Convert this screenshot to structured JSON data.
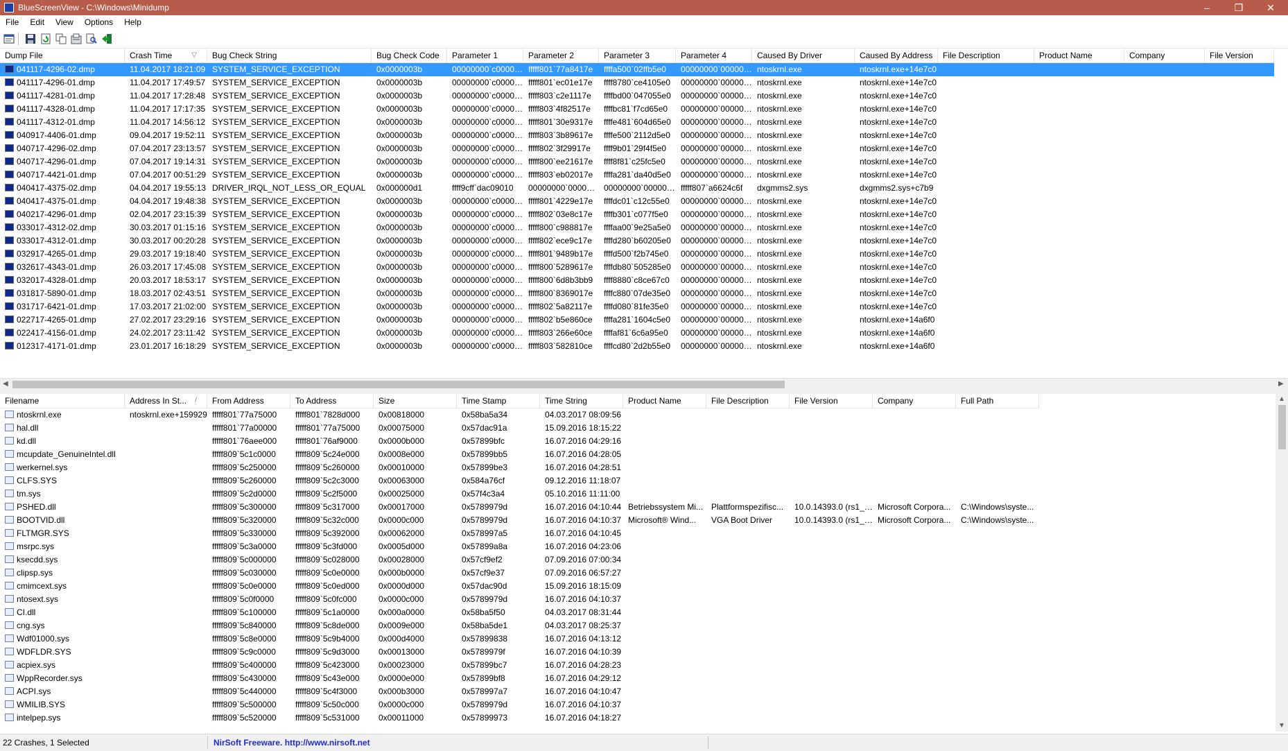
{
  "window": {
    "title": "BlueScreenView  -  C:\\Windows\\Minidump",
    "minimize": "–",
    "maximize": "❐",
    "close": "✕"
  },
  "menu": [
    "File",
    "Edit",
    "View",
    "Options",
    "Help"
  ],
  "toolbar": [
    "properties-icon",
    "save-icon",
    "refresh-icon",
    "copy-icon",
    "options-icon",
    "find-icon",
    "exit-icon"
  ],
  "crashes": {
    "columns": [
      "Dump File",
      "Crash Time",
      "Bug Check String",
      "Bug Check Code",
      "Parameter 1",
      "Parameter 2",
      "Parameter 3",
      "Parameter 4",
      "Caused By Driver",
      "Caused By Address",
      "File Description",
      "Product Name",
      "Company",
      "File Version"
    ],
    "sort_indicator": "▽",
    "rows": [
      [
        "041117-4296-02.dmp",
        "11.04.2017 18:21:09",
        "SYSTEM_SERVICE_EXCEPTION",
        "0x0000003b",
        "00000000`c00000...",
        "fffff801`77a8417e",
        "ffffa500`02ffb5e0",
        "00000000`000000...",
        "ntoskrnl.exe",
        "ntoskrnl.exe+14e7c0",
        "",
        "",
        "",
        ""
      ],
      [
        "041117-4296-01.dmp",
        "11.04.2017 17:49:57",
        "SYSTEM_SERVICE_EXCEPTION",
        "0x0000003b",
        "00000000`c00000...",
        "fffff801`ec01e17e",
        "ffff8780`ce4105e0",
        "00000000`000000...",
        "ntoskrnl.exe",
        "ntoskrnl.exe+14e7c0",
        "",
        "",
        "",
        ""
      ],
      [
        "041117-4281-01.dmp",
        "11.04.2017 17:28:48",
        "SYSTEM_SERVICE_EXCEPTION",
        "0x0000003b",
        "00000000`c00000...",
        "fffff803`c2e1117e",
        "ffffbd00`047055e0",
        "00000000`000000...",
        "ntoskrnl.exe",
        "ntoskrnl.exe+14e7c0",
        "",
        "",
        "",
        ""
      ],
      [
        "041117-4328-01.dmp",
        "11.04.2017 17:17:35",
        "SYSTEM_SERVICE_EXCEPTION",
        "0x0000003b",
        "00000000`c00000...",
        "fffff803`4f82517e",
        "ffffbc81`f7cd65e0",
        "00000000`000000...",
        "ntoskrnl.exe",
        "ntoskrnl.exe+14e7c0",
        "",
        "",
        "",
        ""
      ],
      [
        "041117-4312-01.dmp",
        "11.04.2017 14:56:12",
        "SYSTEM_SERVICE_EXCEPTION",
        "0x0000003b",
        "00000000`c00000...",
        "fffff801`30e9317e",
        "ffffe481`604d65e0",
        "00000000`000000...",
        "ntoskrnl.exe",
        "ntoskrnl.exe+14e7c0",
        "",
        "",
        "",
        ""
      ],
      [
        "040917-4406-01.dmp",
        "09.04.2017 19:52:11",
        "SYSTEM_SERVICE_EXCEPTION",
        "0x0000003b",
        "00000000`c00000...",
        "fffff803`3b89617e",
        "ffffe500`2112d5e0",
        "00000000`000000...",
        "ntoskrnl.exe",
        "ntoskrnl.exe+14e7c0",
        "",
        "",
        "",
        ""
      ],
      [
        "040717-4296-02.dmp",
        "07.04.2017 23:13:57",
        "SYSTEM_SERVICE_EXCEPTION",
        "0x0000003b",
        "00000000`c00000...",
        "fffff802`3f29917e",
        "ffff9b01`29f4f5e0",
        "00000000`000000...",
        "ntoskrnl.exe",
        "ntoskrnl.exe+14e7c0",
        "",
        "",
        "",
        ""
      ],
      [
        "040717-4296-01.dmp",
        "07.04.2017 19:14:31",
        "SYSTEM_SERVICE_EXCEPTION",
        "0x0000003b",
        "00000000`c00000...",
        "fffff800`ee21617e",
        "ffff8f81`c25fc5e0",
        "00000000`000000...",
        "ntoskrnl.exe",
        "ntoskrnl.exe+14e7c0",
        "",
        "",
        "",
        ""
      ],
      [
        "040717-4421-01.dmp",
        "07.04.2017 00:51:29",
        "SYSTEM_SERVICE_EXCEPTION",
        "0x0000003b",
        "00000000`c00000...",
        "fffff803`eb02017e",
        "ffffa281`da40d5e0",
        "00000000`000000...",
        "ntoskrnl.exe",
        "ntoskrnl.exe+14e7c0",
        "",
        "",
        "",
        ""
      ],
      [
        "040417-4375-02.dmp",
        "04.04.2017 19:55:13",
        "DRIVER_IRQL_NOT_LESS_OR_EQUAL",
        "0x000000d1",
        "ffff9cff`dac09010",
        "00000000`000000...",
        "00000000`000000...",
        "fffff807`a6624c6f",
        "dxgmms2.sys",
        "dxgmms2.sys+c7b9",
        "",
        "",
        "",
        ""
      ],
      [
        "040417-4375-01.dmp",
        "04.04.2017 19:48:38",
        "SYSTEM_SERVICE_EXCEPTION",
        "0x0000003b",
        "00000000`c00000...",
        "fffff801`4229e17e",
        "ffffdc01`c12c55e0",
        "00000000`000000...",
        "ntoskrnl.exe",
        "ntoskrnl.exe+14e7c0",
        "",
        "",
        "",
        ""
      ],
      [
        "040217-4296-01.dmp",
        "02.04.2017 23:15:39",
        "SYSTEM_SERVICE_EXCEPTION",
        "0x0000003b",
        "00000000`c00000...",
        "fffff802`03e8c17e",
        "ffffb301`c077f5e0",
        "00000000`000000...",
        "ntoskrnl.exe",
        "ntoskrnl.exe+14e7c0",
        "",
        "",
        "",
        ""
      ],
      [
        "033017-4312-02.dmp",
        "30.03.2017 01:15:16",
        "SYSTEM_SERVICE_EXCEPTION",
        "0x0000003b",
        "00000000`c00000...",
        "fffff800`c988817e",
        "ffffaa00`9e25a5e0",
        "00000000`000000...",
        "ntoskrnl.exe",
        "ntoskrnl.exe+14e7c0",
        "",
        "",
        "",
        ""
      ],
      [
        "033017-4312-01.dmp",
        "30.03.2017 00:20:28",
        "SYSTEM_SERVICE_EXCEPTION",
        "0x0000003b",
        "00000000`c00000...",
        "fffff802`ece9c17e",
        "ffffd280`b60205e0",
        "00000000`000000...",
        "ntoskrnl.exe",
        "ntoskrnl.exe+14e7c0",
        "",
        "",
        "",
        ""
      ],
      [
        "032917-4265-01.dmp",
        "29.03.2017 19:18:40",
        "SYSTEM_SERVICE_EXCEPTION",
        "0x0000003b",
        "00000000`c00000...",
        "fffff801`9489b17e",
        "ffffd500`f2b745e0",
        "00000000`000000...",
        "ntoskrnl.exe",
        "ntoskrnl.exe+14e7c0",
        "",
        "",
        "",
        ""
      ],
      [
        "032617-4343-01.dmp",
        "26.03.2017 17:45:08",
        "SYSTEM_SERVICE_EXCEPTION",
        "0x0000003b",
        "00000000`c00000...",
        "fffff800`5289617e",
        "ffffdb80`505285e0",
        "00000000`000000...",
        "ntoskrnl.exe",
        "ntoskrnl.exe+14e7c0",
        "",
        "",
        "",
        ""
      ],
      [
        "032017-4328-01.dmp",
        "20.03.2017 18:53:17",
        "SYSTEM_SERVICE_EXCEPTION",
        "0x0000003b",
        "00000000`c00000...",
        "fffff800`6d8b3bb9",
        "ffff8880`c8ce67c0",
        "00000000`000000...",
        "ntoskrnl.exe",
        "ntoskrnl.exe+14e7c0",
        "",
        "",
        "",
        ""
      ],
      [
        "031817-5890-01.dmp",
        "18.03.2017 02:43:51",
        "SYSTEM_SERVICE_EXCEPTION",
        "0x0000003b",
        "00000000`c00000...",
        "fffff800`8369017e",
        "ffffc880`07de35e0",
        "00000000`000000...",
        "ntoskrnl.exe",
        "ntoskrnl.exe+14e7c0",
        "",
        "",
        "",
        ""
      ],
      [
        "031717-6421-01.dmp",
        "17.03.2017 21:02:00",
        "SYSTEM_SERVICE_EXCEPTION",
        "0x0000003b",
        "00000000`c00000...",
        "fffff802`5a82117e",
        "ffffd080`81fe35e0",
        "00000000`000000...",
        "ntoskrnl.exe",
        "ntoskrnl.exe+14e7c0",
        "",
        "",
        "",
        ""
      ],
      [
        "022717-4265-01.dmp",
        "27.02.2017 23:29:16",
        "SYSTEM_SERVICE_EXCEPTION",
        "0x0000003b",
        "00000000`c00000...",
        "fffff802`b5e860ce",
        "ffffa281`1604c5e0",
        "00000000`000000...",
        "ntoskrnl.exe",
        "ntoskrnl.exe+14a6f0",
        "",
        "",
        "",
        ""
      ],
      [
        "022417-4156-01.dmp",
        "24.02.2017 23:11:42",
        "SYSTEM_SERVICE_EXCEPTION",
        "0x0000003b",
        "00000000`c00000...",
        "fffff803`266e60ce",
        "ffffaf81`6c6a95e0",
        "00000000`000000...",
        "ntoskrnl.exe",
        "ntoskrnl.exe+14a6f0",
        "",
        "",
        "",
        ""
      ],
      [
        "012317-4171-01.dmp",
        "23.01.2017 16:18:29",
        "SYSTEM_SERVICE_EXCEPTION",
        "0x0000003b",
        "00000000`c00000...",
        "fffff803`582810ce",
        "ffffcd80`2d2b55e0",
        "00000000`000000...",
        "ntoskrnl.exe",
        "ntoskrnl.exe+14a6f0",
        "",
        "",
        "",
        ""
      ]
    ]
  },
  "modules": {
    "columns": [
      "Filename",
      "Address In St...",
      "From Address",
      "To Address",
      "Size",
      "Time Stamp",
      "Time String",
      "Product Name",
      "File Description",
      "File Version",
      "Company",
      "Full Path"
    ],
    "sort_indicator": "/",
    "rows": [
      [
        "ntoskrnl.exe",
        "ntoskrnl.exe+159929",
        "fffff801`77a75000",
        "fffff801`7828d000",
        "0x00818000",
        "0x58ba5a34",
        "04.03.2017 08:09:56",
        "",
        "",
        "",
        "",
        ""
      ],
      [
        "hal.dll",
        "",
        "fffff801`77a00000",
        "fffff801`77a75000",
        "0x00075000",
        "0x57dac91a",
        "15.09.2016 18:15:22",
        "",
        "",
        "",
        "",
        ""
      ],
      [
        "kd.dll",
        "",
        "fffff801`76aee000",
        "fffff801`76af9000",
        "0x0000b000",
        "0x57899bfc",
        "16.07.2016 04:29:16",
        "",
        "",
        "",
        "",
        ""
      ],
      [
        "mcupdate_GenuineIntel.dll",
        "",
        "fffff809`5c1c0000",
        "fffff809`5c24e000",
        "0x0008e000",
        "0x57899bb5",
        "16.07.2016 04:28:05",
        "",
        "",
        "",
        "",
        ""
      ],
      [
        "werkernel.sys",
        "",
        "fffff809`5c250000",
        "fffff809`5c260000",
        "0x00010000",
        "0x57899be3",
        "16.07.2016 04:28:51",
        "",
        "",
        "",
        "",
        ""
      ],
      [
        "CLFS.SYS",
        "",
        "fffff809`5c260000",
        "fffff809`5c2c3000",
        "0x00063000",
        "0x584a76cf",
        "09.12.2016 11:18:07",
        "",
        "",
        "",
        "",
        ""
      ],
      [
        "tm.sys",
        "",
        "fffff809`5c2d0000",
        "fffff809`5c2f5000",
        "0x00025000",
        "0x57f4c3a4",
        "05.10.2016 11:11:00",
        "",
        "",
        "",
        "",
        ""
      ],
      [
        "PSHED.dll",
        "",
        "fffff809`5c300000",
        "fffff809`5c317000",
        "0x00017000",
        "0x5789979d",
        "16.07.2016 04:10:44",
        "Betriebssystem Mi...",
        "Plattformspezifisc...",
        "10.0.14393.0 (rs1_r...",
        "Microsoft Corpora...",
        "C:\\Windows\\syste..."
      ],
      [
        "BOOTVID.dll",
        "",
        "fffff809`5c320000",
        "fffff809`5c32c000",
        "0x0000c000",
        "0x5789979d",
        "16.07.2016 04:10:37",
        "Microsoft® Wind...",
        "VGA Boot Driver",
        "10.0.14393.0 (rs1_r...",
        "Microsoft Corpora...",
        "C:\\Windows\\syste..."
      ],
      [
        "FLTMGR.SYS",
        "",
        "fffff809`5c330000",
        "fffff809`5c392000",
        "0x00062000",
        "0x578997a5",
        "16.07.2016 04:10:45",
        "",
        "",
        "",
        "",
        ""
      ],
      [
        "msrpc.sys",
        "",
        "fffff809`5c3a0000",
        "fffff809`5c3fd000",
        "0x0005d000",
        "0x57899a8a",
        "16.07.2016 04:23:06",
        "",
        "",
        "",
        "",
        ""
      ],
      [
        "ksecdd.sys",
        "",
        "fffff809`5c000000",
        "fffff809`5c028000",
        "0x00028000",
        "0x57cf9ef2",
        "07.09.2016 07:00:34",
        "",
        "",
        "",
        "",
        ""
      ],
      [
        "clipsp.sys",
        "",
        "fffff809`5c030000",
        "fffff809`5c0e0000",
        "0x000b0000",
        "0x57cf9e37",
        "07.09.2016 06:57:27",
        "",
        "",
        "",
        "",
        ""
      ],
      [
        "cmimcext.sys",
        "",
        "fffff809`5c0e0000",
        "fffff809`5c0ed000",
        "0x0000d000",
        "0x57dac90d",
        "15.09.2016 18:15:09",
        "",
        "",
        "",
        "",
        ""
      ],
      [
        "ntosext.sys",
        "",
        "fffff809`5c0f0000",
        "fffff809`5c0fc000",
        "0x0000c000",
        "0x5789979d",
        "16.07.2016 04:10:37",
        "",
        "",
        "",
        "",
        ""
      ],
      [
        "CI.dll",
        "",
        "fffff809`5c100000",
        "fffff809`5c1a0000",
        "0x000a0000",
        "0x58ba5f50",
        "04.03.2017 08:31:44",
        "",
        "",
        "",
        "",
        ""
      ],
      [
        "cng.sys",
        "",
        "fffff809`5c840000",
        "fffff809`5c8de000",
        "0x0009e000",
        "0x58ba5de1",
        "04.03.2017 08:25:37",
        "",
        "",
        "",
        "",
        ""
      ],
      [
        "Wdf01000.sys",
        "",
        "fffff809`5c8e0000",
        "fffff809`5c9b4000",
        "0x000d4000",
        "0x57899838",
        "16.07.2016 04:13:12",
        "",
        "",
        "",
        "",
        ""
      ],
      [
        "WDFLDR.SYS",
        "",
        "fffff809`5c9c0000",
        "fffff809`5c9d3000",
        "0x00013000",
        "0x5789979f",
        "16.07.2016 04:10:39",
        "",
        "",
        "",
        "",
        ""
      ],
      [
        "acpiex.sys",
        "",
        "fffff809`5c400000",
        "fffff809`5c423000",
        "0x00023000",
        "0x57899bc7",
        "16.07.2016 04:28:23",
        "",
        "",
        "",
        "",
        ""
      ],
      [
        "WppRecorder.sys",
        "",
        "fffff809`5c430000",
        "fffff809`5c43e000",
        "0x0000e000",
        "0x57899bf8",
        "16.07.2016 04:29:12",
        "",
        "",
        "",
        "",
        ""
      ],
      [
        "ACPI.sys",
        "",
        "fffff809`5c440000",
        "fffff809`5c4f3000",
        "0x000b3000",
        "0x578997a7",
        "16.07.2016 04:10:47",
        "",
        "",
        "",
        "",
        ""
      ],
      [
        "WMILIB.SYS",
        "",
        "fffff809`5c500000",
        "fffff809`5c50c000",
        "0x0000c000",
        "0x5789979d",
        "16.07.2016 04:10:37",
        "",
        "",
        "",
        "",
        ""
      ],
      [
        "intelpep.sys",
        "",
        "fffff809`5c520000",
        "fffff809`5c531000",
        "0x00011000",
        "0x57899973",
        "16.07.2016 04:18:27",
        "",
        "",
        "",
        "",
        ""
      ]
    ]
  },
  "status": {
    "selection": "22 Crashes, 1 Selected",
    "credit": "NirSoft Freeware.  http://www.nirsoft.net"
  }
}
